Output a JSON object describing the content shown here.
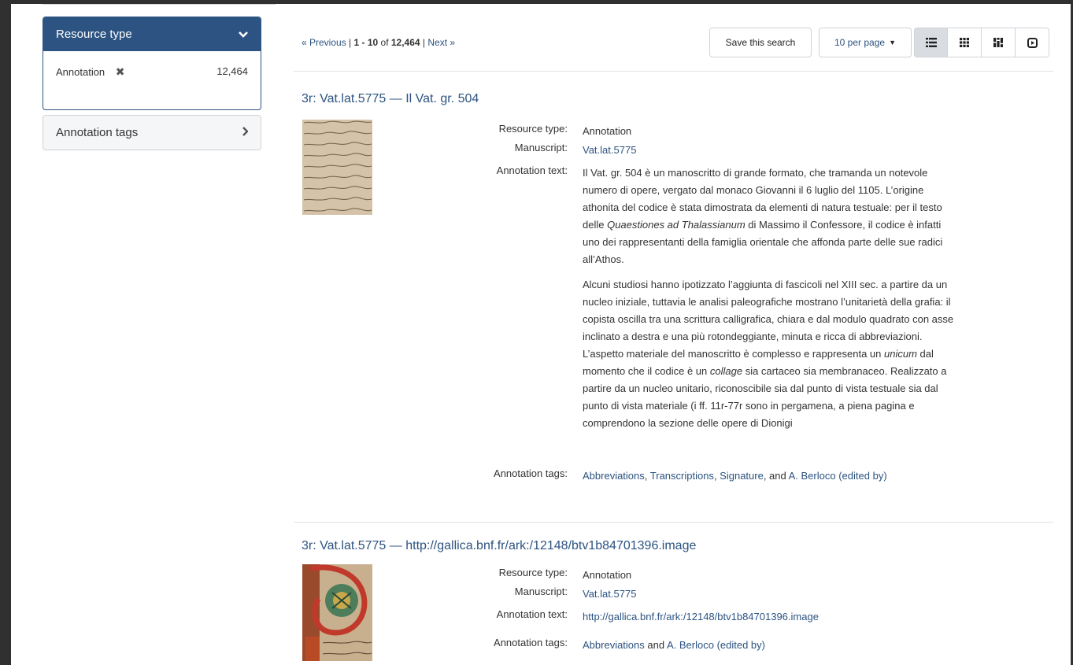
{
  "sidebar": {
    "resource_type": {
      "title": "Resource type",
      "item_label": "Annotation",
      "item_remove": "✖",
      "item_count": "12,464"
    },
    "annotation_tags": {
      "title": "Annotation tags"
    }
  },
  "toolbar": {
    "prev": "« Previous",
    "sep1": " | ",
    "range": "1 - 10",
    "of": " of ",
    "total": "12,464",
    "sep2": " | ",
    "next": "Next »",
    "save_label": "Save this search",
    "per_page_label": "10 per page",
    "views": [
      "list-view",
      "gallery-view",
      "masonry-view",
      "slideshow-view"
    ]
  },
  "labels": {
    "resource_type": "Resource type:",
    "manuscript": "Manuscript:",
    "annotation_text": "Annotation text:",
    "annotation_tags": "Annotation tags:"
  },
  "results": [
    {
      "title": "3r: Vat.lat.5775 — Il Vat. gr. 504",
      "resource_type": "Annotation",
      "manuscript": "Vat.lat.5775",
      "p1_a": "Il Vat. gr. 504 è un manoscritto di grande formato, che tramanda un notevole numero di opere, vergato dal monaco Giovanni il 6 luglio del 1105. L’origine athonita del codice è stata dimostrata da elementi di natura testuale: per il testo delle ",
      "p1_em": "Quaestiones ad Thalassianum",
      "p1_b": " di Massimo il Confessore, il codice è infatti uno dei rappresentanti della famiglia orientale che affonda parte delle sue radici all’Athos.",
      "p2_a": "Alcuni studiosi hanno ipotizzato l’aggiunta di fascicoli nel XIII sec. a partire da un nucleo iniziale, tuttavia le analisi paleografiche mostrano l’unitarietà della grafia: il copista oscilla tra una scrittura calligrafica, chiara e dal modulo quadrato con asse inclinato a destra e una più rotondeggiante, minuta e ricca di abbreviazioni. L’aspetto materiale del manoscritto è complesso e rappresenta un ",
      "p2_em1": "unicum",
      "p2_b": " dal momento che il codice è un ",
      "p2_em2": "collage",
      "p2_c": " sia cartaceo sia membranaceo. Realizzato a partire da un nucleo unitario, riconoscibile sia dal punto di vista testuale sia dal punto di vista materiale (i ff. 11r-77r sono in pergamena, a piena pagina e comprendono la sezione delle opere di Dionigi",
      "tags": [
        "Abbreviations",
        "Transcriptions",
        "Signature",
        "A. Berloco (edited by)"
      ],
      "tag_sep": ", ",
      "tag_and": ", and "
    },
    {
      "title": "3r: Vat.lat.5775 — http://gallica.bnf.fr/ark:/12148/btv1b84701396.image",
      "resource_type": "Annotation",
      "manuscript": "Vat.lat.5775",
      "annotation_text": "http://gallica.bnf.fr/ark:/12148/btv1b84701396.image",
      "tags": [
        "Abbreviations",
        "A. Berloco (edited by)"
      ],
      "tag_and": " and "
    }
  ],
  "colors": {
    "accent": "#2c5381",
    "frame": "#303030"
  }
}
